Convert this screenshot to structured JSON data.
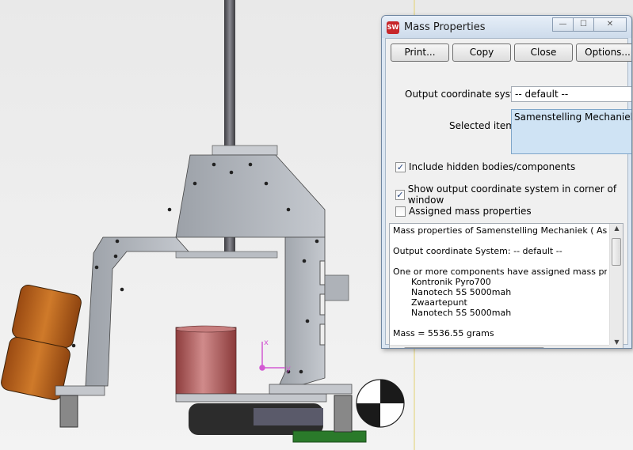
{
  "dialog": {
    "title": "Mass Properties",
    "app_icon_text": "SW",
    "window_buttons": {
      "minimize": "—",
      "maximize": "☐",
      "close": "✕"
    },
    "buttons": [
      "Print...",
      "Copy",
      "Close",
      "Options..."
    ],
    "output_coord_label": "Output coordinate system:",
    "output_coord_value": "-- default --",
    "selected_items_label": "Selected items:",
    "selected_item": "Samenstelling Mechaniek.SLD",
    "checkboxes": [
      {
        "label": "Include hidden bodies/components",
        "checked": true
      },
      {
        "label": "Show output coordinate system in corner of window",
        "checked": true
      },
      {
        "label": "Assigned mass properties",
        "checked": false
      }
    ],
    "results": {
      "line1": "Mass properties of Samenstelling Mechaniek ( Assembly",
      "line2": "Output  coordinate System: -- default --",
      "line3": "One or more components have assigned mass properties",
      "components": [
        "Kontronik Pyro700",
        "Nanotech 5S 5000mah",
        "Zwaartepunt",
        "Nanotech 5S 5000mah"
      ],
      "mass": "Mass = 5536.55 grams"
    }
  },
  "viewport": {
    "axis_labels": {
      "x": "x",
      "y": "y"
    }
  }
}
